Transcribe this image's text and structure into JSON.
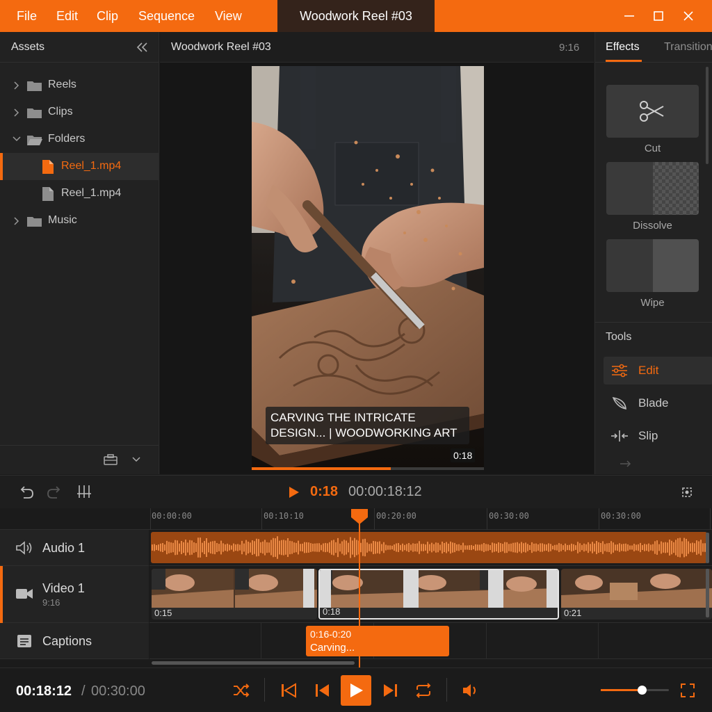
{
  "menu": [
    "File",
    "Edit",
    "Clip",
    "Sequence",
    "View"
  ],
  "document_title": "Woodwork Reel #03",
  "assets": {
    "title": "Assets",
    "tree": [
      {
        "label": "Reels"
      },
      {
        "label": "Clips"
      },
      {
        "label": "Folders"
      },
      {
        "label": "Reel_1.mp4"
      },
      {
        "label": "Reel_1.mp4"
      },
      {
        "label": "Music"
      }
    ]
  },
  "preview": {
    "title": "Woodwork Reel #03",
    "aspect": "9:16",
    "caption_line1": "CARVING THE INTRICATE",
    "caption_line2": "DESIGN... | WOODWORKING ART",
    "time_badge": "0:18",
    "progress": 0.6
  },
  "right_panel": {
    "tabs": [
      "Effects",
      "Transitions"
    ],
    "effects": [
      {
        "label": "Cut"
      },
      {
        "label": "Dissolve"
      },
      {
        "label": "Wipe"
      }
    ],
    "tools_title": "Tools",
    "tools": [
      {
        "label": "Edit"
      },
      {
        "label": "Blade"
      },
      {
        "label": "Slip"
      }
    ]
  },
  "timeline": {
    "current_short": "0:18",
    "current_timecode": "00:00:18:12",
    "ruler_labels": [
      "00:00:00",
      "00:10:10",
      "00:20:00",
      "00:30:00",
      "00:30:00"
    ],
    "tracks": {
      "audio": {
        "name": "Audio 1"
      },
      "video": {
        "name": "Video 1",
        "sub": "9:16"
      },
      "captions": {
        "name": "Captions"
      }
    },
    "clips": [
      "0:15",
      "0:18",
      "0:21"
    ],
    "caption_clip": {
      "range": "0:16-0:20",
      "text": "Carving..."
    }
  },
  "transport": {
    "current": "00:18:12",
    "separator": "/",
    "total": "00:30:00",
    "volume": 0.6
  },
  "colors": {
    "accent": "#f46a10",
    "bg": "#1b1b1b"
  }
}
